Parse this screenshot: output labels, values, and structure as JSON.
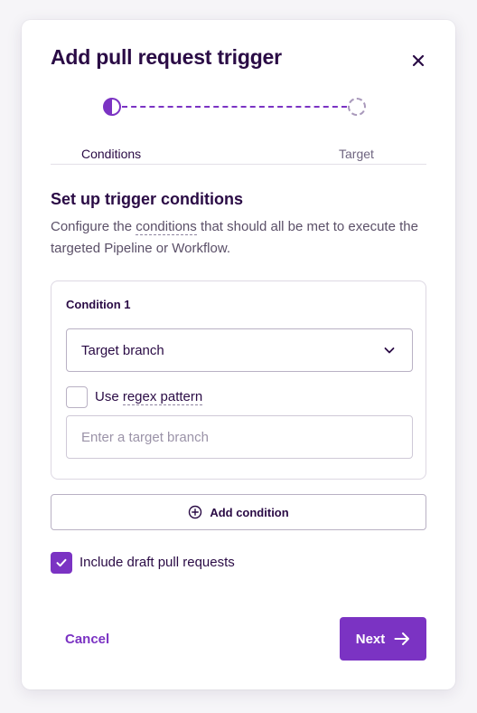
{
  "modal": {
    "title": "Add pull request trigger"
  },
  "stepper": {
    "steps": [
      {
        "label": "Conditions",
        "state": "active"
      },
      {
        "label": "Target",
        "state": "pending"
      }
    ]
  },
  "section": {
    "title": "Set up trigger conditions",
    "desc_prefix": "Configure the ",
    "desc_link": "conditions",
    "desc_suffix": " that should all be met to execute the targeted Pipeline or Workflow."
  },
  "condition": {
    "title": "Condition 1",
    "select_value": "Target branch",
    "regex_label_prefix": "Use ",
    "regex_label_link": "regex pattern",
    "regex_checked": false,
    "input_placeholder": "Enter a target branch",
    "input_value": ""
  },
  "add_condition": {
    "label": "Add condition"
  },
  "draft": {
    "label": "Include draft pull requests",
    "checked": true
  },
  "footer": {
    "cancel_label": "Cancel",
    "next_label": "Next"
  },
  "colors": {
    "accent": "#7b33c3",
    "title": "#2a0b45",
    "muted": "#5b5068"
  },
  "icons": {
    "close": "close-icon",
    "chevron": "chevron-down-icon",
    "plus": "plus-circle-icon",
    "check": "check-icon",
    "arrow": "arrow-right-icon"
  }
}
